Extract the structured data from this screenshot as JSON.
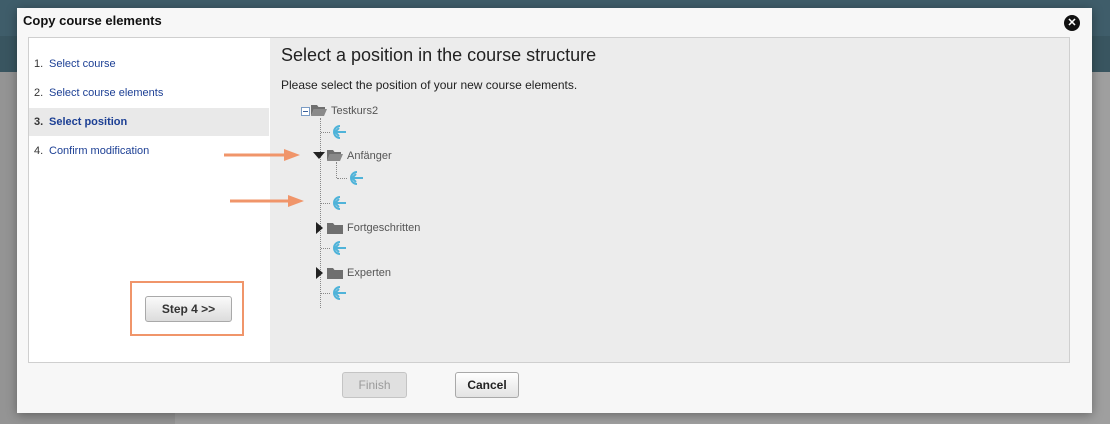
{
  "dialog": {
    "title": "Copy course elements"
  },
  "steps": [
    {
      "num": "1.",
      "label": "Select course"
    },
    {
      "num": "2.",
      "label": "Select course elements"
    },
    {
      "num": "3.",
      "label": "Select position"
    },
    {
      "num": "4.",
      "label": "Confirm modification"
    }
  ],
  "active_step": 3,
  "content": {
    "title": "Select a position in the course structure",
    "subtitle": "Please select the position of your new course elements."
  },
  "tree": {
    "root": "Testkurs2",
    "nodes": [
      "Anfänger",
      "Fortgeschritten",
      "Experten"
    ]
  },
  "buttons": {
    "next": "Step 4 >>",
    "finish": "Finish",
    "cancel": "Cancel"
  },
  "colors": {
    "annotation": "#f0956a",
    "insert_icon": "#4fb3d9",
    "link": "#1c3f94"
  },
  "icons": [
    "close-icon",
    "folder-open-icon",
    "folder-icon",
    "insert-position-icon",
    "arrow-annotation"
  ]
}
